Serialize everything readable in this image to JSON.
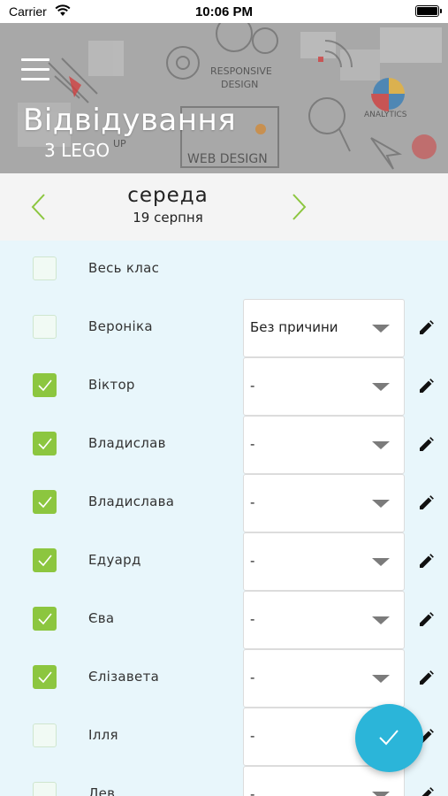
{
  "status_bar": {
    "carrier": "Carrier",
    "time": "10:06 PM"
  },
  "header": {
    "title": "Відвідування",
    "subtitle": "3 LEGO",
    "background_words": [
      "RESPONSIVE",
      "DESIGN",
      "ANALYTICS",
      "WEB DESIGN",
      "UP"
    ]
  },
  "date_nav": {
    "day": "середа",
    "date": "19 серпня"
  },
  "all_class": {
    "label": "Весь клас",
    "checked": false
  },
  "students": [
    {
      "name": "Вероніка",
      "checked": false,
      "reason": "Без причини"
    },
    {
      "name": "Віктор",
      "checked": true,
      "reason": "-"
    },
    {
      "name": "Владислав",
      "checked": true,
      "reason": "-"
    },
    {
      "name": "Владислава",
      "checked": true,
      "reason": "-"
    },
    {
      "name": "Едуард",
      "checked": true,
      "reason": "-"
    },
    {
      "name": "Єва",
      "checked": true,
      "reason": "-"
    },
    {
      "name": "Єлізавета",
      "checked": true,
      "reason": "-"
    },
    {
      "name": "Ілля",
      "checked": false,
      "reason": "-"
    },
    {
      "name": "Лев",
      "checked": false,
      "reason": "-"
    }
  ],
  "colors": {
    "accent_green": "#8cc63f",
    "fab_blue": "#2bb5d9",
    "list_bg": "#e8f6fb"
  },
  "icons": {
    "menu": "hamburger-icon",
    "prev": "chevron-left-icon",
    "next": "chevron-right-icon",
    "edit": "pencil-icon",
    "fab": "checkmark-icon"
  }
}
